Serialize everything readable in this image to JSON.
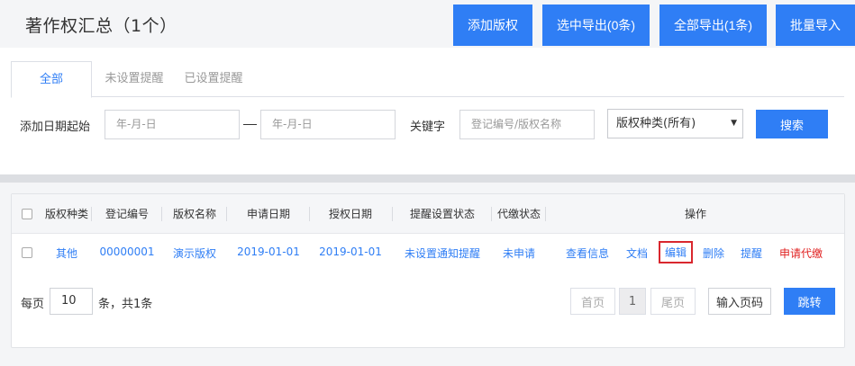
{
  "header": {
    "title": "著作权汇总（1个）",
    "buttons": {
      "add": "添加版权",
      "export_selected": "选中导出(0条)",
      "export_all": "全部导出(1条)",
      "batch_import": "批量导入"
    }
  },
  "tabs": [
    "全部",
    "未设置提醒",
    "已设置提醒"
  ],
  "filters": {
    "date_start_label": "添加日期起始",
    "date_placeholder": "年-月-日",
    "keyword_label": "关键字",
    "keyword_placeholder": "登记编号/版权名称",
    "type_select": "版权种类(所有)",
    "search_button": "搜索"
  },
  "table": {
    "columns": [
      "版权种类",
      "登记编号",
      "版权名称",
      "申请日期",
      "授权日期",
      "提醒设置状态",
      "代缴状态",
      "操作"
    ],
    "rows": [
      {
        "type": "其他",
        "reg_no": "00000001",
        "name": "演示版权",
        "apply_date": "2019-01-01",
        "auth_date": "2019-01-01",
        "reminder_status": "未设置通知提醒",
        "payment_status": "未申请",
        "actions": {
          "view": "查看信息",
          "docs": "文档",
          "edit": "编辑",
          "delete": "删除",
          "remind": "提醒",
          "apply_pay": "申请代缴"
        }
      }
    ]
  },
  "pagination": {
    "per_page_label": "每页",
    "per_page_value": "10",
    "total_text": "条，共1条",
    "first": "首页",
    "current": "1",
    "last": "尾页",
    "jump_placeholder": "输入页码",
    "jump_button": "跳转"
  }
}
